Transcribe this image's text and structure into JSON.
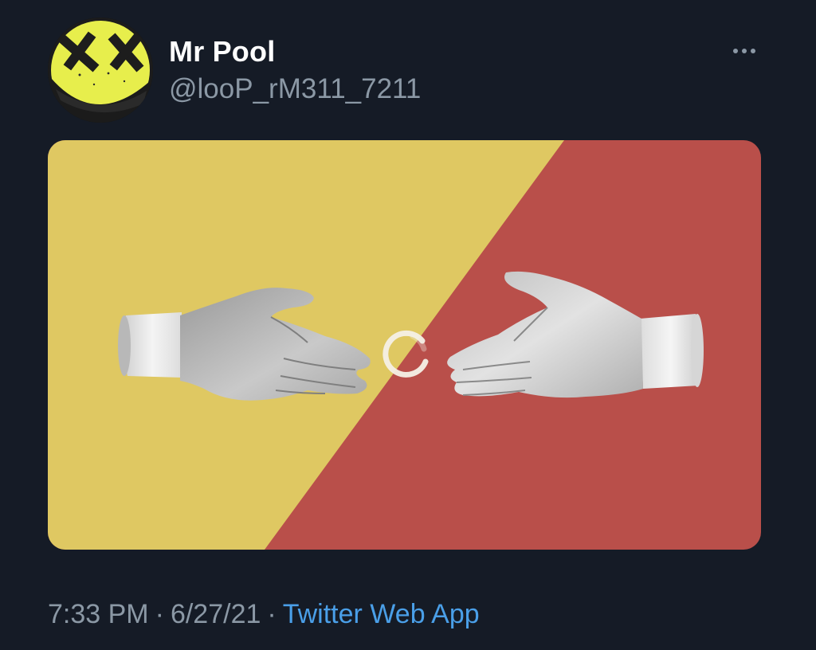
{
  "author": {
    "display_name": "Mr Pool",
    "handle": "@looP_rM311_7211",
    "avatar_icon": "yellow-smiley-face-with-x-eyes"
  },
  "menu": {
    "more_icon": "more-horizontal-icon"
  },
  "media": {
    "type": "image",
    "colors": {
      "left": "#dfc862",
      "right": "#b94f4a",
      "spinner": "#f4f0e6"
    },
    "loading": true
  },
  "meta": {
    "time": "7:33 PM",
    "separator": "·",
    "date": "6/27/21",
    "source": "Twitter Web App"
  },
  "theme": {
    "background": "#151b26",
    "text_primary": "#ffffff",
    "text_secondary": "#8b98a5",
    "link": "#4a9fe8"
  }
}
